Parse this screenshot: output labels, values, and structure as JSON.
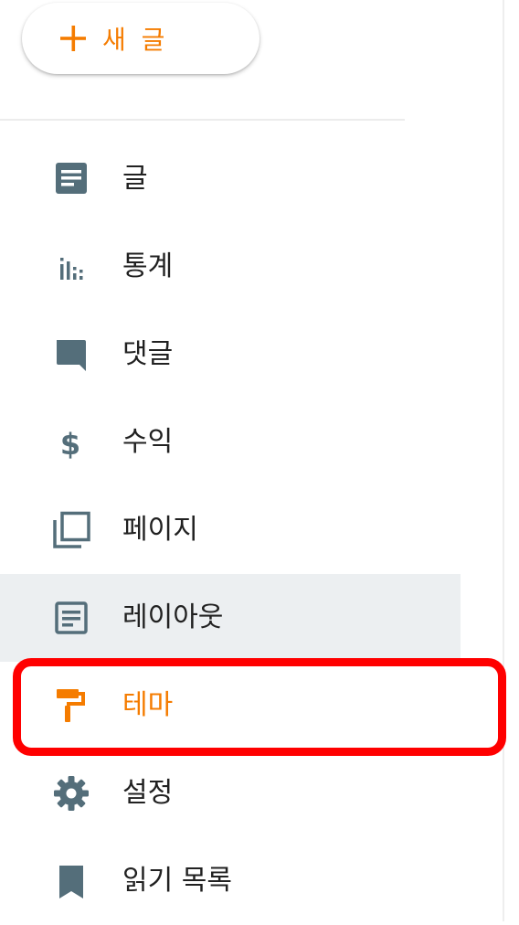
{
  "new_post": {
    "label": "새 글"
  },
  "nav": {
    "items": [
      {
        "label": "글",
        "icon": "posts-icon"
      },
      {
        "label": "통계",
        "icon": "stats-icon"
      },
      {
        "label": "댓글",
        "icon": "comment-icon"
      },
      {
        "label": "수익",
        "icon": "dollar-icon"
      },
      {
        "label": "페이지",
        "icon": "pages-icon"
      },
      {
        "label": "레이아웃",
        "icon": "layout-icon"
      },
      {
        "label": "테마",
        "icon": "paint-roller-icon"
      },
      {
        "label": "설정",
        "icon": "gear-icon"
      },
      {
        "label": "읽기 목록",
        "icon": "bookmark-icon"
      }
    ]
  },
  "colors": {
    "accent": "#f57c00",
    "icon": "#546e7a",
    "hover_bg": "#eceff1",
    "highlight": "#ff0000"
  }
}
